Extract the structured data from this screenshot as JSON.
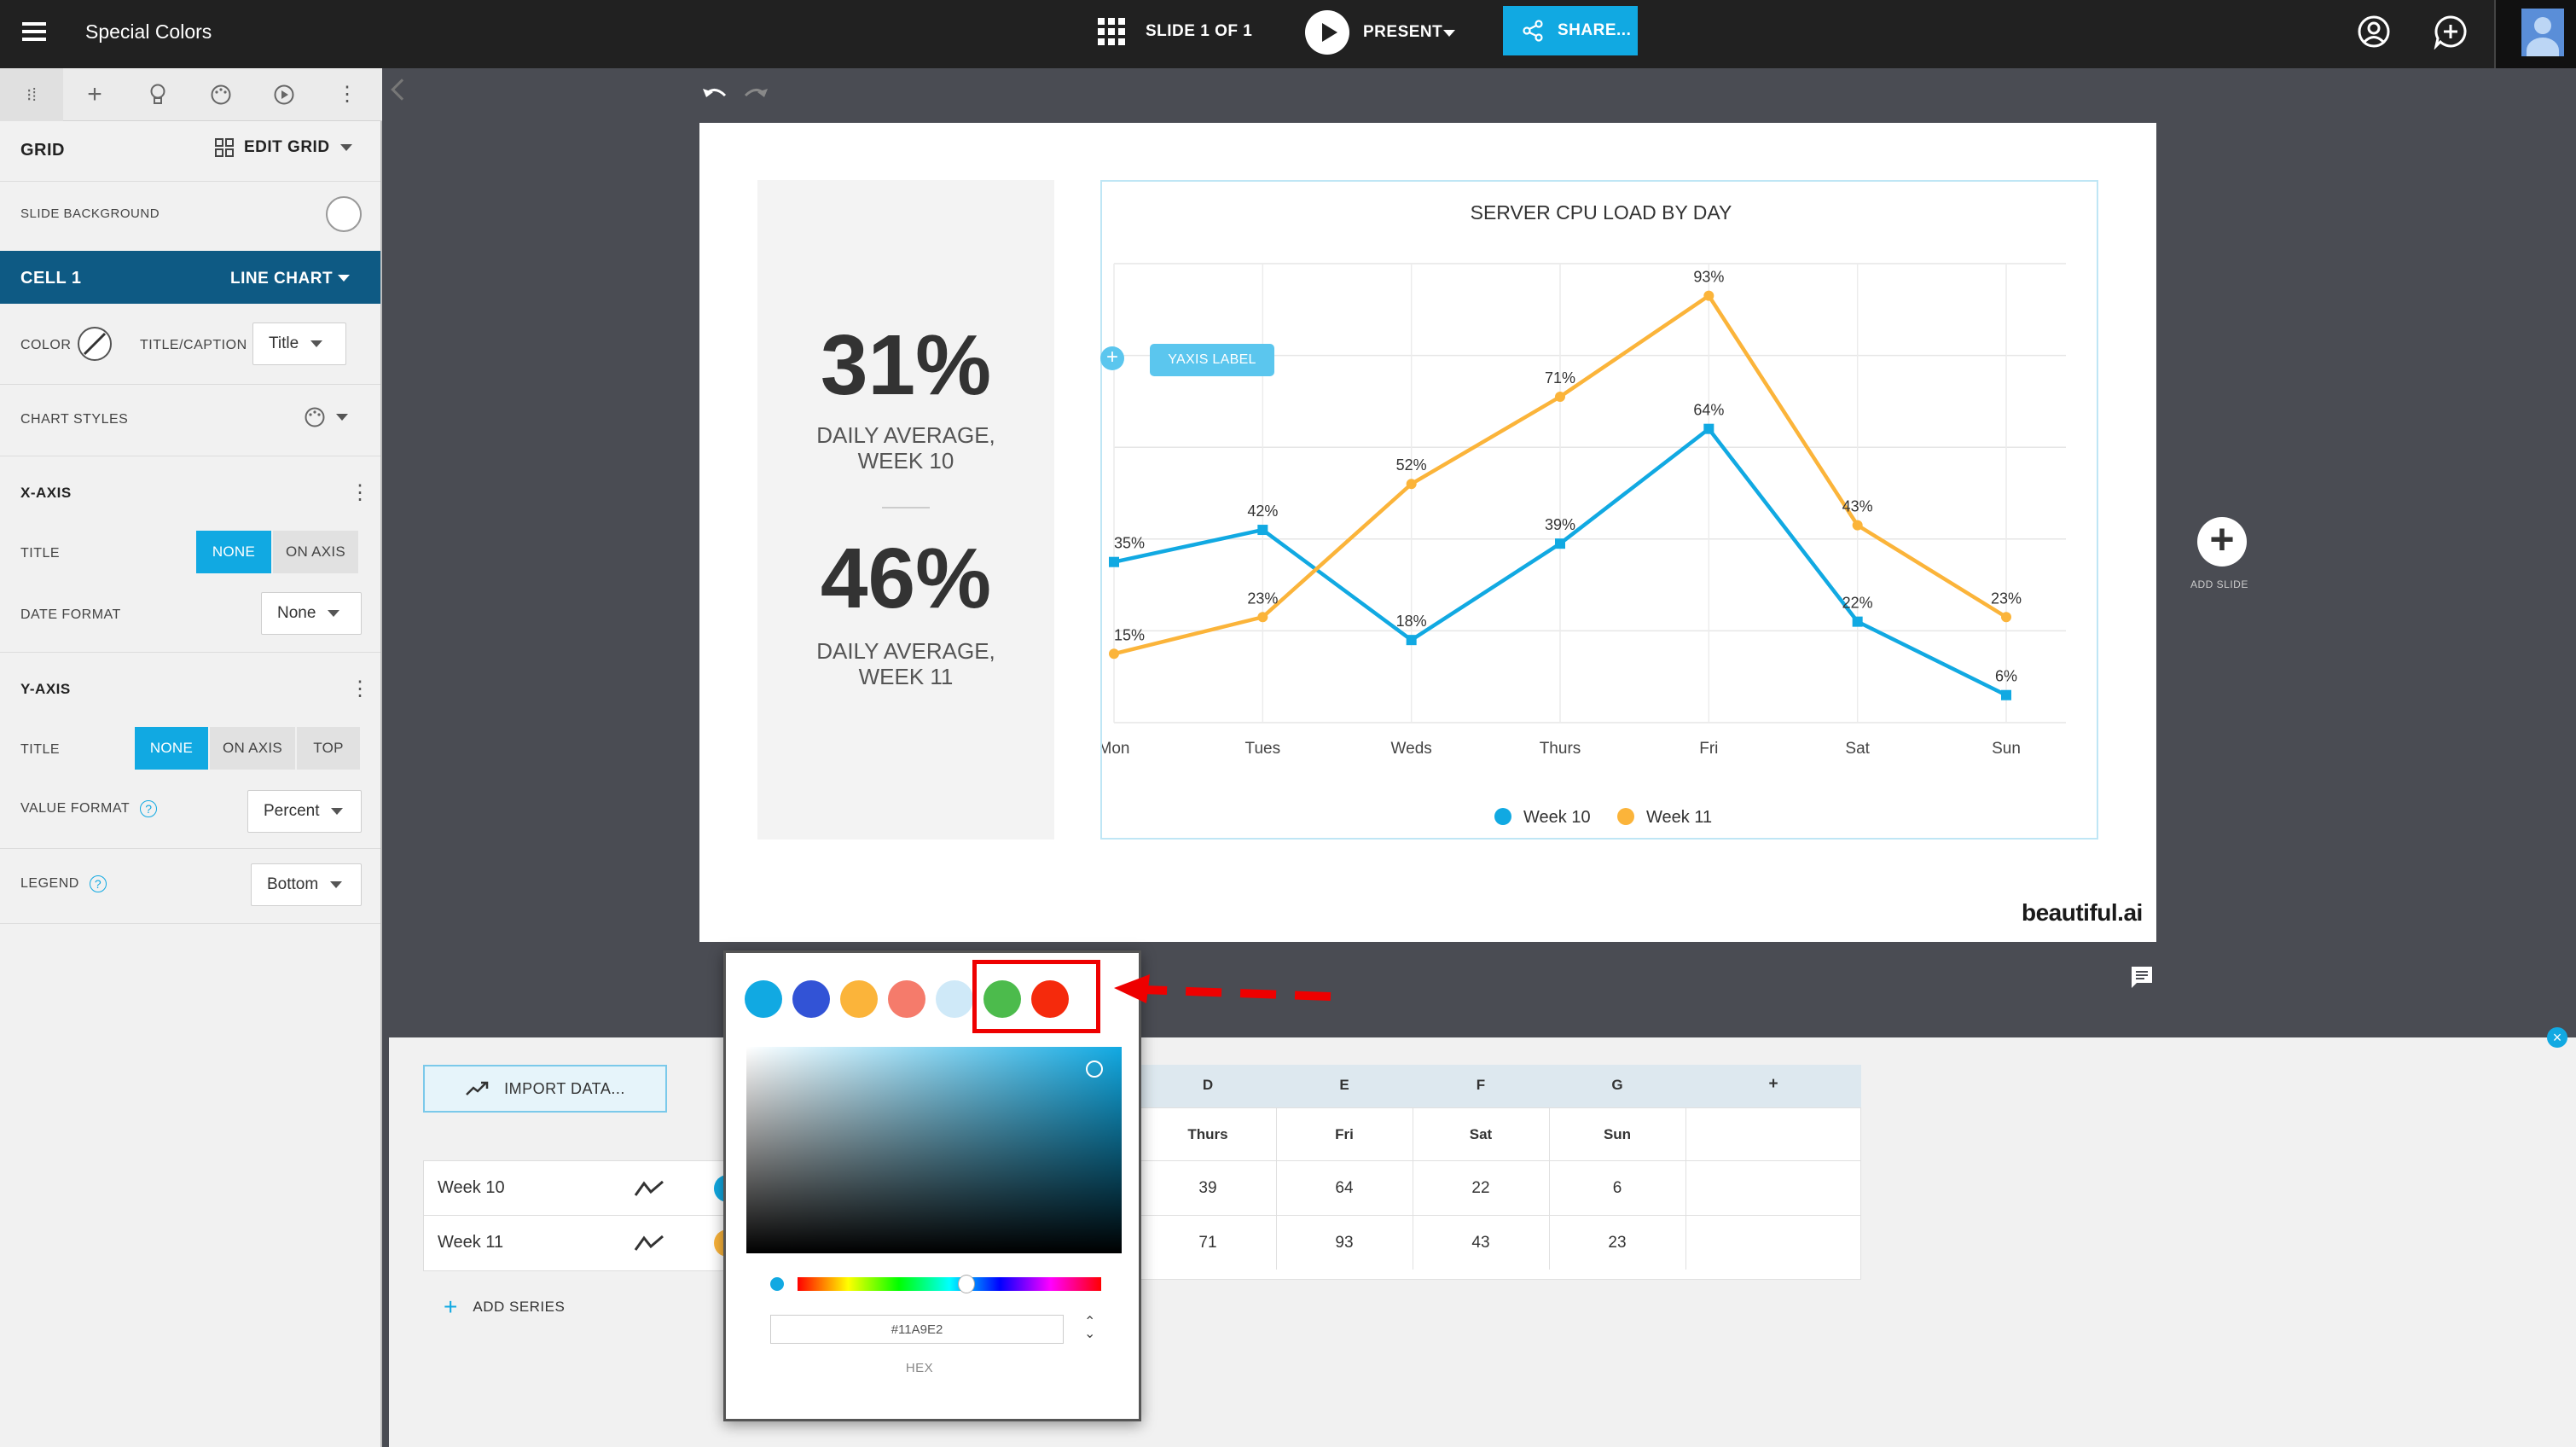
{
  "app": {
    "title": "Special Colors"
  },
  "topbar": {
    "slide_counter": "SLIDE 1 OF 1",
    "present_label": "PRESENT",
    "share_label": "SHARE..."
  },
  "sidebar": {
    "grid_label": "GRID",
    "edit_grid_label": "EDIT GRID",
    "slide_background_label": "SLIDE BACKGROUND",
    "cell_label": "CELL 1",
    "cell_type": "LINE CHART",
    "color_label": "COLOR",
    "title_caption_label": "TITLE/CAPTION",
    "title_caption_value": "Title",
    "chart_styles_label": "CHART STYLES",
    "x_axis": {
      "header": "X-AXIS",
      "title_label": "TITLE",
      "title_options": [
        "NONE",
        "ON AXIS"
      ],
      "date_format_label": "DATE FORMAT",
      "date_format_value": "None"
    },
    "y_axis": {
      "header": "Y-AXIS",
      "title_label": "TITLE",
      "title_options": [
        "NONE",
        "ON AXIS",
        "TOP"
      ],
      "value_format_label": "VALUE FORMAT",
      "value_format_value": "Percent"
    },
    "legend_label": "LEGEND",
    "legend_value": "Bottom"
  },
  "slide": {
    "stat1_value": "31%",
    "stat1_label": "DAILY AVERAGE,\nWEEK 10",
    "stat2_value": "46%",
    "stat2_label": "DAILY AVERAGE,\nWEEK 11",
    "yaxis_label_button": "YAXIS LABEL",
    "brand": "beautiful.ai",
    "add_slide_label": "ADD SLIDE"
  },
  "chart_data": {
    "type": "line",
    "title": "SERVER CPU LOAD BY DAY",
    "categories": [
      "Mon",
      "Tues",
      "Weds",
      "Thurs",
      "Fri",
      "Sat",
      "Sun"
    ],
    "series": [
      {
        "name": "Week 10",
        "values": [
          35,
          42,
          18,
          39,
          64,
          22,
          6
        ],
        "color": "#11a9e2"
      },
      {
        "name": "Week 11",
        "values": [
          15,
          23,
          52,
          71,
          93,
          43,
          23
        ],
        "color": "#fbb43a"
      }
    ],
    "ylim": [
      0,
      100
    ],
    "value_suffix": "%",
    "grid": true,
    "legend": "bottom"
  },
  "data_panel": {
    "import_label": "IMPORT DATA...",
    "add_series_label": "ADD SERIES",
    "series_rows": [
      {
        "name": "Week 10",
        "color": "#11a9e2"
      },
      {
        "name": "Week 11",
        "color": "#fbb43a"
      }
    ],
    "columns": [
      "D",
      "E",
      "F",
      "G",
      "+"
    ],
    "header_row": [
      "Thurs",
      "Fri",
      "Sat",
      "Sun"
    ],
    "rows": [
      [
        "39",
        "64",
        "22",
        "6"
      ],
      [
        "71",
        "93",
        "43",
        "23"
      ]
    ]
  },
  "color_picker": {
    "swatches": [
      "#11a9e2",
      "#3253d6",
      "#fbb43a",
      "#f57b6b",
      "#cfe9f8",
      "#4cbb4c",
      "#f52a0c"
    ],
    "hex_value": "#11A9E2",
    "hex_label": "HEX"
  }
}
